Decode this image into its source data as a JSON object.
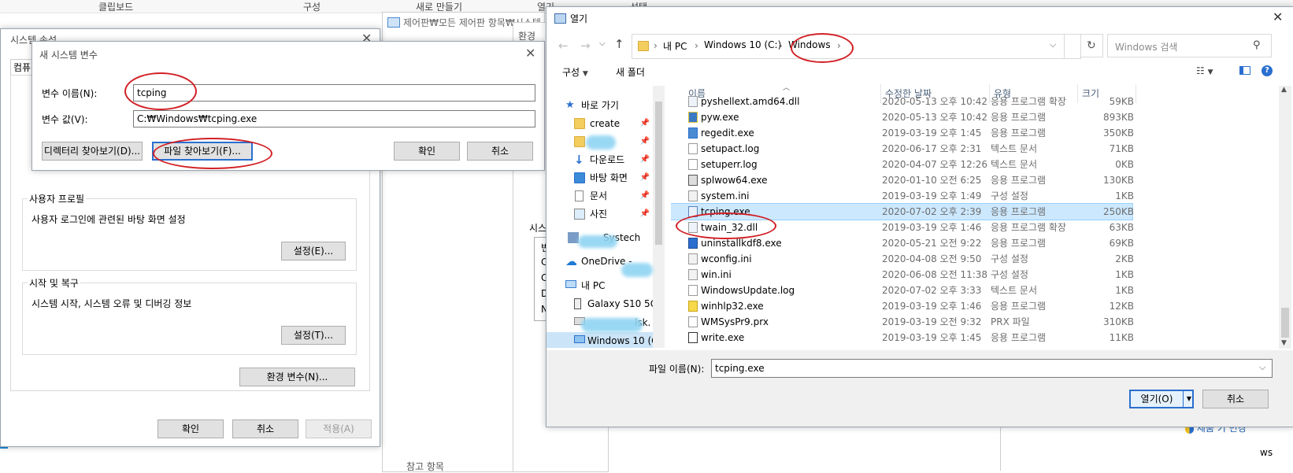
{
  "ribbon": {
    "clipboard": "클립보드",
    "organize": "구성",
    "new_item": "새로 만들기",
    "open": "열기",
    "select": "선택"
  },
  "sysprops": {
    "title": "시스템 속성",
    "tab_computer": "컴퓨",
    "user_profile": {
      "label": "사용자 프로필",
      "desc": "사용자 로그인에 관련된 바탕 화면 설정",
      "button": "설정(E)..."
    },
    "startup": {
      "label": "시작 및 복구",
      "desc": "시스템 시작, 시스템 오류 및 디버깅 정보",
      "button": "설정(T)..."
    },
    "env_button": "환경 변수(N)...",
    "ok": "확인",
    "cancel": "취소",
    "apply": "적용(A)"
  },
  "newvar": {
    "title": "새 시스템 변수",
    "name_label": "변수 이름(N):",
    "name_value": "tcping",
    "value_label": "변수 값(V):",
    "value_value": "C:₩Windows₩tcping.exe",
    "browse_dir": "디렉터리 찾아보기(D)...",
    "browse_file": "파일 찾아보기(F)...",
    "ok": "확인",
    "cancel": "취소"
  },
  "cpanel": {
    "title": "제어판₩모든 제어판 항목₩시스템",
    "env_title": "환경",
    "sys_label": "시스",
    "related": "참고 항목",
    "side_letters": [
      "변",
      "C",
      "C",
      "D",
      "N"
    ]
  },
  "bg": {
    "change_key": "제품 키 변경",
    "ws": "ws"
  },
  "open": {
    "title": "열기",
    "breadcrumb": [
      "내 PC",
      "Windows 10 (C:)",
      "Windows"
    ],
    "search_placeholder": "Windows 검색",
    "toolbar": {
      "organize": "구성",
      "new_folder": "새 폴더"
    },
    "nav": [
      {
        "label": "바로 가기",
        "icon": "star-icon"
      },
      {
        "label": "create",
        "icon": "folder-icon",
        "pin": true
      },
      {
        "label": "",
        "icon": "folder-icon",
        "pin": true
      },
      {
        "label": "다운로드",
        "icon": "download-icon",
        "pin": true
      },
      {
        "label": "바탕 화면",
        "icon": "folder-icon",
        "pin": true
      },
      {
        "label": "문서",
        "icon": "document-icon",
        "pin": true
      },
      {
        "label": "사진",
        "icon": "picture-icon",
        "pin": true
      },
      {
        "label": "Systech",
        "icon": "folder-icon"
      },
      {
        "label": "OneDrive -",
        "icon": "cloud-icon"
      },
      {
        "label": "내 PC",
        "icon": "computer-icon"
      },
      {
        "label": "Galaxy S10 5G",
        "icon": "phone-icon"
      },
      {
        "label": "isk.",
        "icon": "drive-icon"
      },
      {
        "label": "Windows 10 (C:",
        "icon": "drive-icon"
      }
    ],
    "columns": {
      "name": "이름",
      "date": "수정한 날짜",
      "type": "유형",
      "size": "크기"
    },
    "files": [
      {
        "name": "pyshellext.amd64.dll",
        "date": "2020-05-13 오후 10:42",
        "type": "응용 프로그램 확장",
        "size": "59KB",
        "icon": "dll-icon"
      },
      {
        "name": "pyw.exe",
        "date": "2020-05-13 오후 10:42",
        "type": "응용 프로그램",
        "size": "893KB",
        "icon": "python-icon"
      },
      {
        "name": "regedit.exe",
        "date": "2019-03-19 오후 1:45",
        "type": "응용 프로그램",
        "size": "350KB",
        "icon": "regedit-icon"
      },
      {
        "name": "setupact.log",
        "date": "2020-06-17 오후 2:31",
        "type": "텍스트 문서",
        "size": "71KB",
        "icon": "text-file-icon"
      },
      {
        "name": "setuperr.log",
        "date": "2020-04-07 오후 12:26",
        "type": "텍스트 문서",
        "size": "0KB",
        "icon": "text-file-icon"
      },
      {
        "name": "splwow64.exe",
        "date": "2020-01-10 오전 6:25",
        "type": "응용 프로그램",
        "size": "130KB",
        "icon": "printer-icon"
      },
      {
        "name": "system.ini",
        "date": "2019-03-19 오후 1:49",
        "type": "구성 설정",
        "size": "1KB",
        "icon": "settings-file-icon"
      },
      {
        "name": "tcping.exe",
        "date": "2020-07-02 오후 2:39",
        "type": "응용 프로그램",
        "size": "250KB",
        "icon": "exe-icon",
        "selected": true
      },
      {
        "name": "twain_32.dll",
        "date": "2019-03-19 오후 1:46",
        "type": "응용 프로그램 확장",
        "size": "63KB",
        "icon": "dll-icon"
      },
      {
        "name": "uninstallkdf8.exe",
        "date": "2020-05-21 오전 9:22",
        "type": "응용 프로그램",
        "size": "69KB",
        "icon": "k-app-icon"
      },
      {
        "name": "wconfig.ini",
        "date": "2020-04-08 오전 9:50",
        "type": "구성 설정",
        "size": "2KB",
        "icon": "settings-file-icon"
      },
      {
        "name": "win.ini",
        "date": "2020-06-08 오전 11:38",
        "type": "구성 설정",
        "size": "1KB",
        "icon": "settings-file-icon"
      },
      {
        "name": "WindowsUpdate.log",
        "date": "2020-07-02 오후 3:33",
        "type": "텍스트 문서",
        "size": "1KB",
        "icon": "text-file-icon"
      },
      {
        "name": "winhlp32.exe",
        "date": "2019-03-19 오후 1:46",
        "type": "응용 프로그램",
        "size": "12KB",
        "icon": "help-icon"
      },
      {
        "name": "WMSysPr9.prx",
        "date": "2019-03-19 오전 9:32",
        "type": "PRX 파일",
        "size": "310KB",
        "icon": "file-icon"
      },
      {
        "name": "write.exe",
        "date": "2019-03-19 오후 1:45",
        "type": "응용 프로그램",
        "size": "11KB",
        "icon": "write-icon"
      }
    ],
    "filename_label": "파일 이름(N):",
    "filename_value": "tcping.exe",
    "open_button": "열기(O)",
    "cancel_button": "취소"
  }
}
